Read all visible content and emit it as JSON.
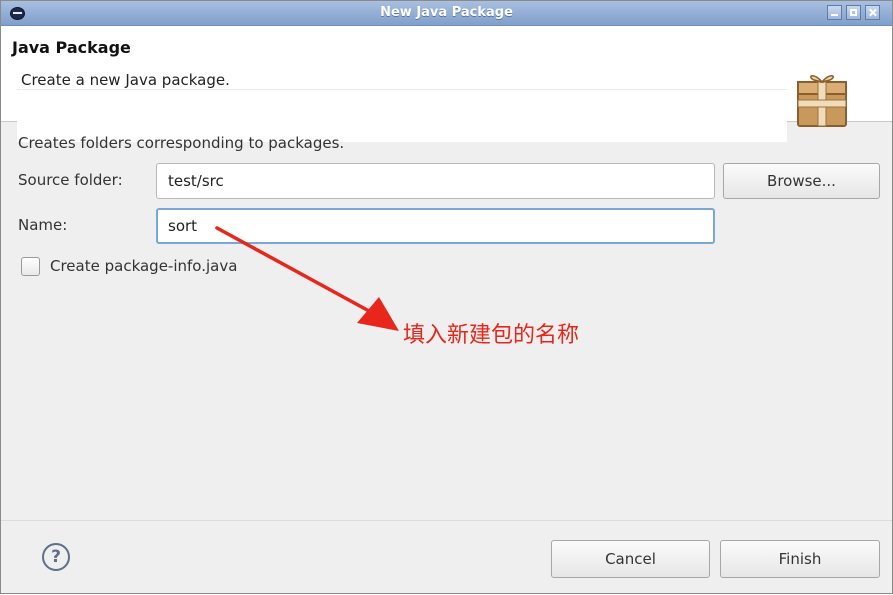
{
  "window": {
    "title": "New Java Package"
  },
  "header": {
    "title": "Java Package",
    "description": "Create a new Java package."
  },
  "form": {
    "description": "Creates folders corresponding to packages.",
    "source_folder_label": "Source folder:",
    "source_folder_value": "test/src",
    "browse_label": "Browse...",
    "name_label": "Name:",
    "name_value": "sort",
    "package_info_label": "Create package-info.java",
    "package_info_checked": false
  },
  "annotation": {
    "text": "填入新建包的名称",
    "color": "#e8261c"
  },
  "footer": {
    "cancel_label": "Cancel",
    "finish_label": "Finish"
  },
  "icons": {
    "app": "eclipse-icon",
    "banner": "package-icon",
    "help": "help-icon"
  }
}
